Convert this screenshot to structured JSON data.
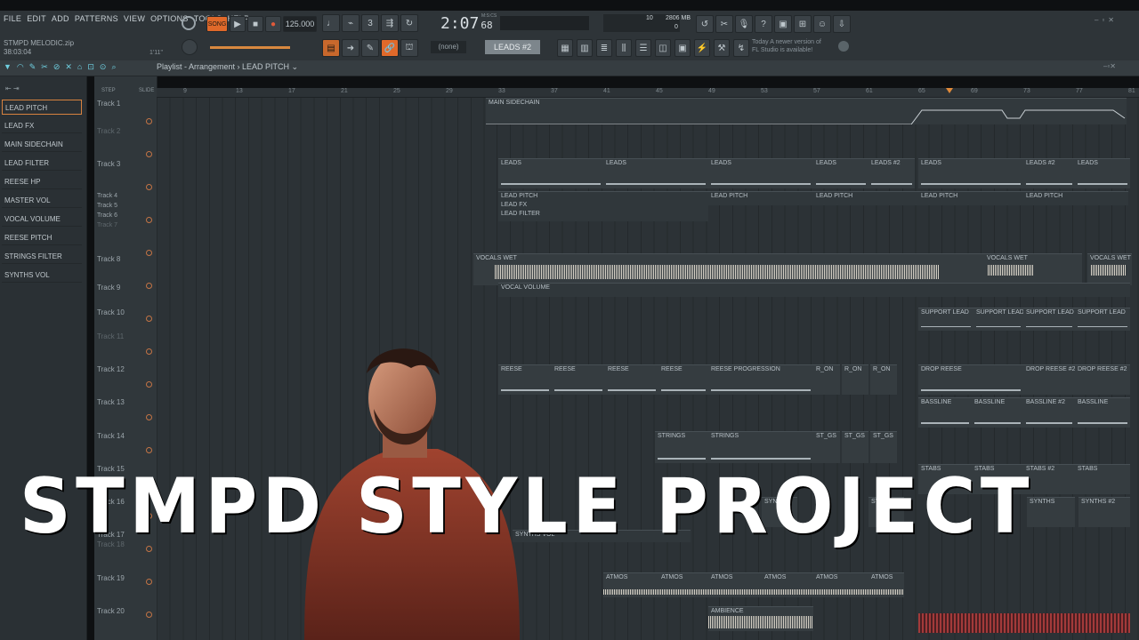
{
  "menu": [
    "FILE",
    "EDIT",
    "ADD",
    "PATTERNS",
    "VIEW",
    "OPTIONS",
    "TOOLS",
    "HELP"
  ],
  "transport": {
    "song_label": "SONG",
    "tempo": "125.000",
    "time": "2:07",
    "time_sub": "68",
    "time_unit": "M:S:CS"
  },
  "memory": {
    "cpu": "10",
    "ram": "2806 MB",
    "voices": "0"
  },
  "project": {
    "name": "STMPD MELODIC.zip",
    "duration": "38:03:04",
    "position": "1'11\""
  },
  "pattern": {
    "none": "(none)",
    "current": "LEADS #2"
  },
  "news": {
    "line1": "Today  A newer version of",
    "line2": "FL Studio is available!"
  },
  "playlist": {
    "title": "Playlist - Arrangement › LEAD PITCH ⌄",
    "step": "STEP",
    "slide": "SLIDE"
  },
  "automation_clips": [
    "LEAD PITCH",
    "LEAD FX",
    "MAIN SIDECHAIN",
    "LEAD FILTER",
    "REESE HP",
    "MASTER VOL",
    "VOCAL VOLUME",
    "REESE PITCH",
    "STRINGS FILTER",
    "SYNTHS VOL"
  ],
  "tracks": [
    {
      "label": "Track 1",
      "dim": false
    },
    {
      "label": "Track 2",
      "dim": true
    },
    {
      "label": "Track 3",
      "dim": false
    },
    {
      "label": "Track 4",
      "dim": false
    },
    {
      "label": "Track 5",
      "dim": false
    },
    {
      "label": "Track 6",
      "dim": false
    },
    {
      "label": "Track 7",
      "dim": true
    },
    {
      "label": "Track 8",
      "dim": false
    },
    {
      "label": "Track 9",
      "dim": false
    },
    {
      "label": "Track 10",
      "dim": false
    },
    {
      "label": "Track 11",
      "dim": true
    },
    {
      "label": "Track 12",
      "dim": false
    },
    {
      "label": "Track 13",
      "dim": false
    },
    {
      "label": "Track 14",
      "dim": false
    },
    {
      "label": "Track 15",
      "dim": false
    },
    {
      "label": "Track 16",
      "dim": false
    },
    {
      "label": "Track 17",
      "dim": false
    },
    {
      "label": "Track 18",
      "dim": true
    },
    {
      "label": "Track 19",
      "dim": false
    },
    {
      "label": "Track 20",
      "dim": false
    }
  ],
  "ruler": [
    "9",
    "13",
    "17",
    "21",
    "25",
    "29",
    "33",
    "37",
    "41",
    "45",
    "49",
    "53",
    "57",
    "61",
    "65",
    "69",
    "73",
    "77",
    "81"
  ],
  "clips": {
    "main_sidechain": "MAIN SIDECHAIN",
    "leads": "LEADS",
    "leads2": "LEADS #2",
    "lead_pitch": "LEAD PITCH",
    "lead_fx": "LEAD FX",
    "lead_filter": "LEAD FILTER",
    "vocals_wet": "VOCALS WET",
    "vocal_volume": "VOCAL VOLUME",
    "support_lead": "SUPPORT LEAD",
    "reese": "REESE",
    "reese_prog": "REESE PROGRESSION",
    "r_on": "R_ON",
    "drop_reese": "DROP REESE",
    "drop_reese2": "DROP REESE #2",
    "bassline": "BASSLINE",
    "bassline2": "BASSLINE #2",
    "strings": "STRINGS",
    "st_gs": "ST_GS",
    "stabs": "STABS",
    "stabs2": "STABS #2",
    "synths": "SYNTHS",
    "synths2": "SYNTHS #2",
    "synths_vol": "SYNTHS VOL",
    "atmos": "ATMOS",
    "ambience": "AMBIENCE"
  },
  "overlay_title": "STMPD STYLE PROJECT"
}
